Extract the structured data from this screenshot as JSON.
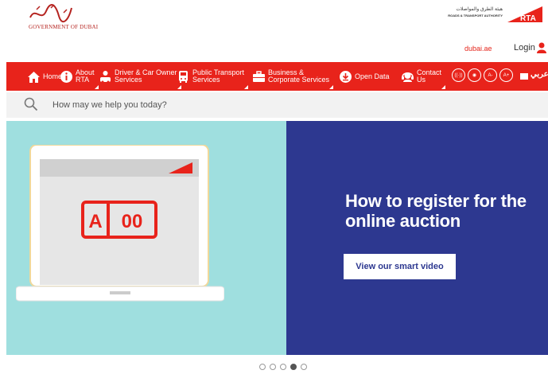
{
  "header": {
    "gov_logo_text": "GOVERNMENT OF DUBAI",
    "rta_arabic": "هيئة الطرق والمواصلات",
    "rta_english": "ROADS & TRANSPORT AUTHORITY",
    "rta_mark_text": "RTA",
    "dubai_link": "dubai.ae",
    "login_label": "Login"
  },
  "nav": {
    "items": [
      {
        "label": "Home",
        "icon": "home-icon"
      },
      {
        "label": "About\nRTA",
        "icon": "about-icon"
      },
      {
        "label": "Driver & Car Owner\nServices",
        "icon": "driver-icon"
      },
      {
        "label": "Public Transport\nServices",
        "icon": "bus-icon"
      },
      {
        "label": "Business &\nCorporate Services",
        "icon": "briefcase-icon"
      },
      {
        "label": "Open Data",
        "icon": "download-icon"
      },
      {
        "label": "Contact\nUs",
        "icon": "headset-icon"
      }
    ],
    "accessibility": [
      "((·))",
      "◉",
      "A-",
      "A+"
    ],
    "arabic_label": "عربي"
  },
  "search": {
    "placeholder": "How may we help you today?"
  },
  "hero": {
    "title": "How to register for the online auction",
    "button_label": "View our smart video",
    "plate_letter": "A",
    "plate_number": "00",
    "colors": {
      "left_bg": "#9fdfdf",
      "right_bg": "#2d3890",
      "accent": "#e8231b"
    }
  },
  "carousel": {
    "count": 5,
    "active_index": 3
  }
}
